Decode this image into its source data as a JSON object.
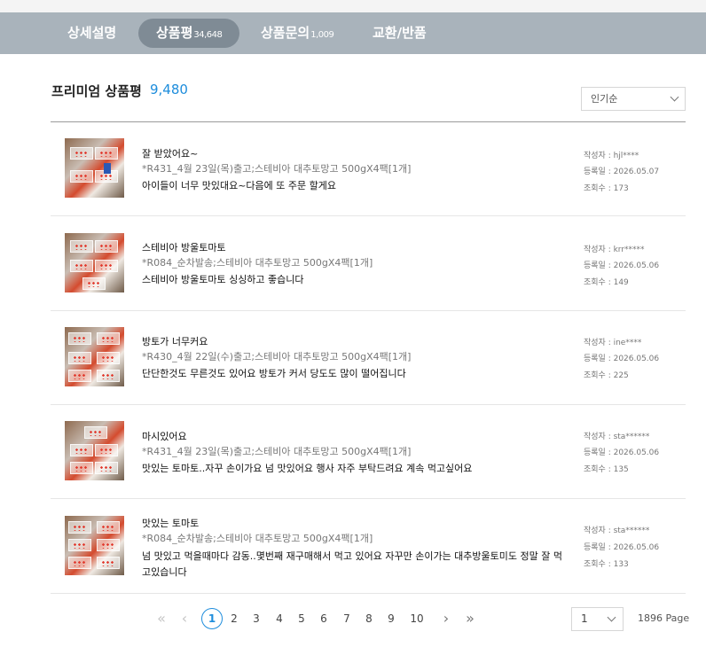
{
  "tabs": [
    {
      "label": "상세설명",
      "count": ""
    },
    {
      "label": "상품평",
      "count": "34,648"
    },
    {
      "label": "상품문의",
      "count": "1,009"
    },
    {
      "label": "교환/반품",
      "count": ""
    }
  ],
  "active_tab": 1,
  "section": {
    "title": "프리미엄 상품평",
    "count": "9,480"
  },
  "sort": {
    "selected": "인기순"
  },
  "reviews": [
    {
      "title": "잘 받았어요~",
      "option": "*R431_4월 23일(목)출고;스테비아 대추토망고 500gX4팩[1개]",
      "body": "아이들이 너무 맛있대요~다음에 또 주문 할게요",
      "author": "작성자 : hjl****",
      "date": "등록일 : 2026.05.07",
      "views": "조회수 : 173"
    },
    {
      "title": "스테비아 방울토마토",
      "option": "*R084_순차발송;스테비아 대추토망고 500gX4팩[1개]",
      "body": "스테비아 방울토마토 싱싱하고 좋습니다",
      "author": "작성자 : krr*****",
      "date": "등록일 : 2026.05.06",
      "views": "조회수 : 149"
    },
    {
      "title": "방토가 너무커요",
      "option": "*R430_4월 22일(수)출고;스테비아 대추토망고 500gX4팩[1개]",
      "body": "단단한것도 무른것도 있어요 방토가 커서 당도도 많이 떨어집니다",
      "author": "작성자 : ine****",
      "date": "등록일 : 2026.05.06",
      "views": "조회수 : 225"
    },
    {
      "title": "마시있어요",
      "option": "*R431_4월 23일(목)출고;스테비아 대추토망고 500gX4팩[1개]",
      "body": "맛있는 토마토..자꾸 손이가요 넘 맛있어요 행사 자주 부탁드려요 계속 먹고싶어요",
      "author": "작성자 : sta******",
      "date": "등록일 : 2026.05.06",
      "views": "조회수 : 135"
    },
    {
      "title": "맛있는 토마토",
      "option": "*R084_순차발송;스테비아 대추토망고 500gX4팩[1개]",
      "body": "넘 맛있고 먹을때마다 감동..몇번째 재구매해서 먹고 있어요 자꾸만 손이가는 대추방울토미도 정말 잘 먹고있습니다",
      "author": "작성자 : sta******",
      "date": "등록일 : 2026.05.06",
      "views": "조회수 : 133"
    }
  ],
  "pagination": {
    "first_icon": "double-chevron-left-icon",
    "prev_icon": "chevron-left-icon",
    "next_icon": "chevron-right-icon",
    "last_icon": "double-chevron-right-icon",
    "pages": [
      "1",
      "2",
      "3",
      "4",
      "5",
      "6",
      "7",
      "8",
      "9",
      "10"
    ],
    "current": "1",
    "page_select": "1",
    "total_label": "1896 Page"
  },
  "colors": {
    "tab_bar": "#a9b3bb",
    "tab_active": "#7f8b95",
    "accent": "#1e8ddc"
  }
}
